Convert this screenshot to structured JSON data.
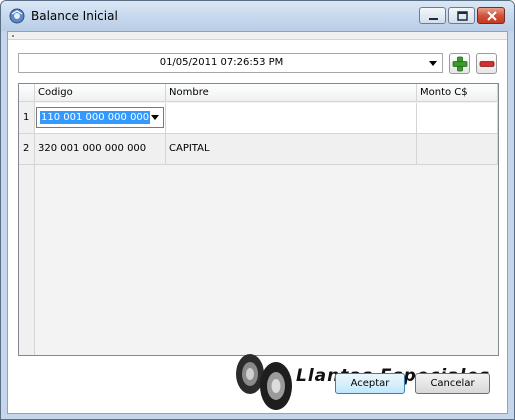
{
  "window": {
    "title": "Balance Inicial"
  },
  "toolbar": {
    "date_value": "01/05/2011 07:26:53 PM",
    "add_icon": "plus-icon",
    "remove_icon": "minus-icon"
  },
  "grid": {
    "columns": [
      "Codigo",
      "Nombre",
      "Monto C$"
    ],
    "rows": [
      {
        "num": "1",
        "codigo": "110 001 000 000 000",
        "nombre": "",
        "monto": ""
      },
      {
        "num": "2",
        "codigo": "320 001 000 000 000",
        "nombre": "CAPITAL",
        "monto": ""
      }
    ]
  },
  "logo": {
    "text": "Llantas Especiales",
    "icon": "tires-icon"
  },
  "buttons": {
    "ok": "Aceptar",
    "cancel": "Cancelar"
  },
  "colors": {
    "add": "#3a9a2a",
    "remove": "#d03030",
    "selection": "#3399ff"
  }
}
